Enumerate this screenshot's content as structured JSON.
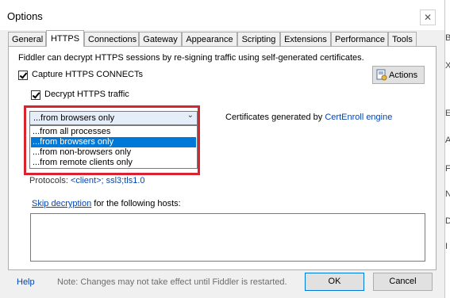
{
  "window": {
    "title": "Options",
    "close_glyph": "✕"
  },
  "tabs": [
    "General",
    "HTTPS",
    "Connections",
    "Gateway",
    "Appearance",
    "Scripting",
    "Extensions",
    "Performance",
    "Tools"
  ],
  "active_tab": "HTTPS",
  "https": {
    "intro": "Fiddler can decrypt HTTPS sessions by re-signing traffic using self-generated certificates.",
    "capture_label": "Capture HTTPS CONNECTs",
    "capture_checked": true,
    "decrypt_label": "Decrypt HTTPS traffic",
    "decrypt_checked": true,
    "actions_label": "Actions",
    "source_select": {
      "value": "...from browsers only",
      "options": [
        "...from all processes",
        "...from browsers only",
        "...from non-browsers only",
        "...from remote clients only"
      ],
      "selected_index": 1
    },
    "certs_text": "Certificates generated by ",
    "certs_link": "CertEnroll engine",
    "protocols_label": "Protocols: ",
    "protocols_value": "<client>; ssl3;tls1.0",
    "skip_link": "Skip decryption",
    "skip_text": " for the following hosts:",
    "hosts_value": ""
  },
  "footer": {
    "help": "Help",
    "note": "Note: Changes may not take effect until Fiddler is restarted.",
    "ok": "OK",
    "cancel": "Cancel"
  },
  "background_window_fragments": [
    "B",
    "X",
    "E",
    "AR",
    "F",
    "N",
    "D",
    "I"
  ]
}
